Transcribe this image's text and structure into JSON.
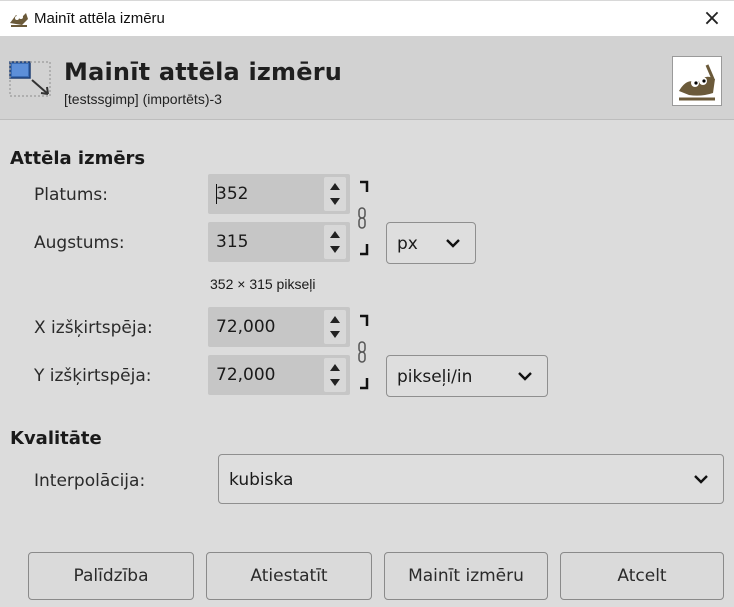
{
  "window": {
    "title": "Mainīt attēla izmēru",
    "close_glyph": "×"
  },
  "header": {
    "title": "Mainīt attēla izmēru",
    "subtitle": "[testssgimp] (importēts)-3"
  },
  "image_size": {
    "section_label": "Attēla izmērs",
    "width_label": "Platums:",
    "width_value": "352",
    "height_label": "Augstums:",
    "height_value": "315",
    "unit": "px",
    "pixel_summary": "352 × 315 pikseļi",
    "xres_label": "X izšķirtspēja:",
    "xres_value": "72,000",
    "yres_label": "Y izšķirtspēja:",
    "yres_value": "72,000",
    "res_unit": "pikseļi/in"
  },
  "quality": {
    "section_label": "Kvalitāte",
    "interpolation_label": "Interpolācija:",
    "interpolation_value": "kubiska"
  },
  "buttons": {
    "help": "Palīdzība",
    "reset": "Atiestatīt",
    "scale": "Mainīt izmēru",
    "cancel": "Atcelt"
  },
  "icons": {
    "app": "gimp-wilber-icon",
    "header": "scale-image-icon",
    "logo": "gimp-wilber-logo",
    "chain": "chain-link-icon",
    "chevron": "chevron-down-icon",
    "spin_up": "spin-up-arrow-icon",
    "spin_down": "spin-down-arrow-icon"
  }
}
